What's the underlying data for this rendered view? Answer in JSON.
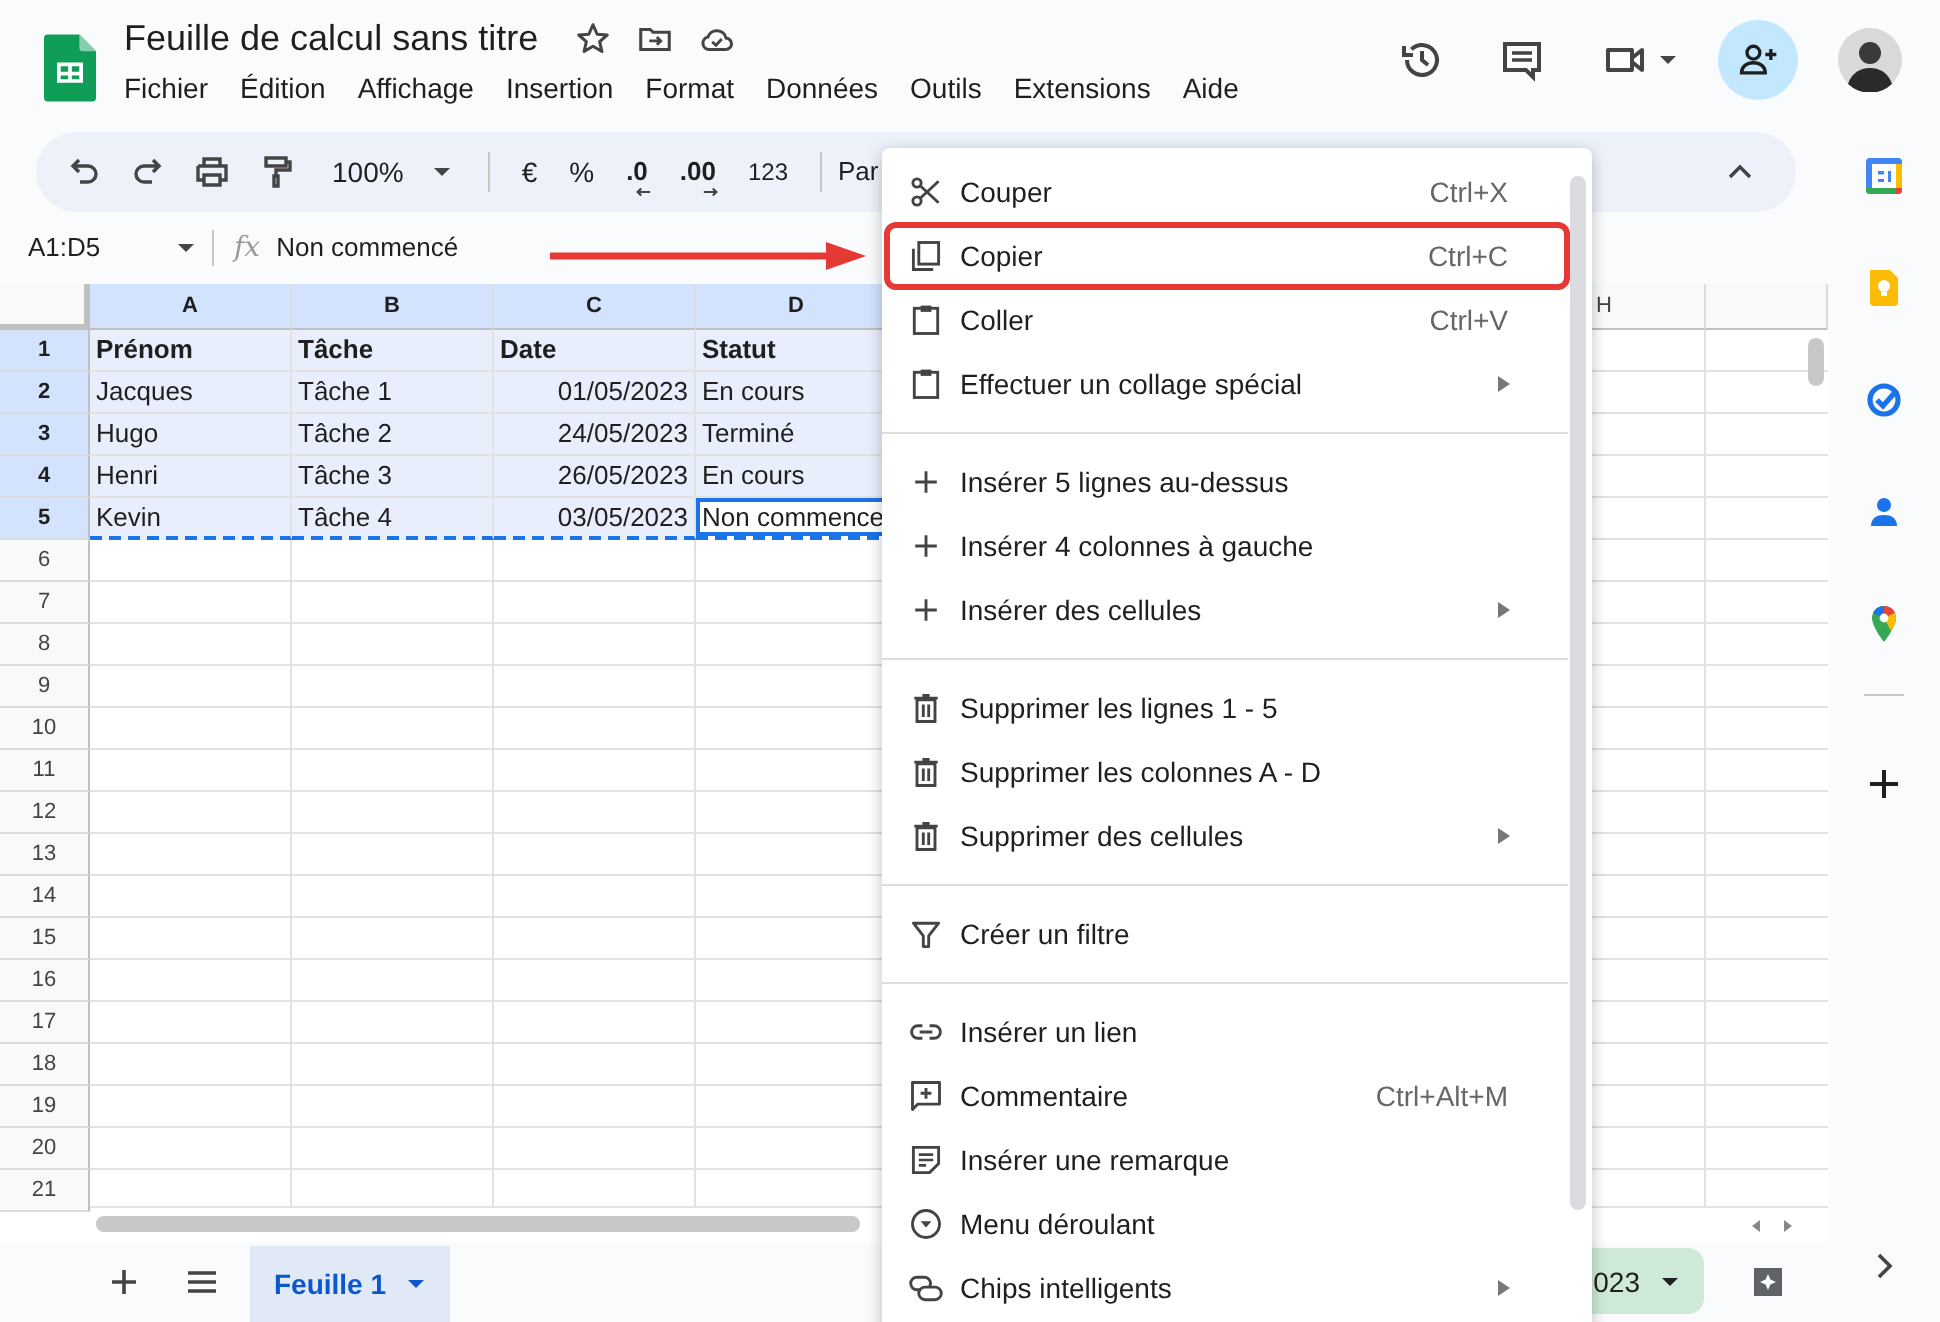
{
  "app": {
    "title": "Feuille de calcul sans titre",
    "menus": [
      "Fichier",
      "Édition",
      "Affichage",
      "Insertion",
      "Format",
      "Données",
      "Outils",
      "Extensions",
      "Aide"
    ]
  },
  "toolbar": {
    "zoom": "100%",
    "format_buttons": [
      "€",
      "%",
      ".0",
      ".00",
      "123"
    ],
    "font": "Par"
  },
  "formula_bar": {
    "name_box": "A1:D5",
    "fx": "fx",
    "value": "Non commencé"
  },
  "grid": {
    "columns": [
      {
        "label": "A",
        "selected": true
      },
      {
        "label": "B",
        "selected": true
      },
      {
        "label": "C",
        "selected": true
      },
      {
        "label": "D",
        "selected": true
      },
      {
        "label": "H",
        "selected": false
      }
    ],
    "rows": [
      {
        "label": "1",
        "selected": true,
        "cells": [
          {
            "text": "Prénom",
            "kind": "header",
            "active": false
          },
          {
            "text": "Tâche",
            "kind": "header",
            "active": false
          },
          {
            "text": "Date",
            "kind": "header",
            "active": false
          },
          {
            "text": "Statut",
            "kind": "header",
            "active": false
          }
        ]
      },
      {
        "label": "2",
        "selected": true,
        "cells": [
          {
            "text": "Jacques",
            "kind": "text",
            "active": false
          },
          {
            "text": "Tâche 1",
            "kind": "text",
            "active": false
          },
          {
            "text": "01/05/2023",
            "kind": "date",
            "active": false
          },
          {
            "text": "En cours",
            "kind": "text",
            "active": false
          }
        ]
      },
      {
        "label": "3",
        "selected": true,
        "cells": [
          {
            "text": "Hugo",
            "kind": "text",
            "active": false
          },
          {
            "text": "Tâche 2",
            "kind": "text",
            "active": false
          },
          {
            "text": "24/05/2023",
            "kind": "date",
            "active": false
          },
          {
            "text": "Terminé",
            "kind": "text",
            "active": false
          }
        ]
      },
      {
        "label": "4",
        "selected": true,
        "cells": [
          {
            "text": "Henri",
            "kind": "text",
            "active": false
          },
          {
            "text": "Tâche 3",
            "kind": "text",
            "active": false
          },
          {
            "text": "26/05/2023",
            "kind": "date",
            "active": false
          },
          {
            "text": "En cours",
            "kind": "text",
            "active": false
          }
        ]
      },
      {
        "label": "5",
        "selected": true,
        "cells": [
          {
            "text": "Kevin",
            "kind": "text",
            "active": false
          },
          {
            "text": "Tâche 4",
            "kind": "text",
            "active": false
          },
          {
            "text": "03/05/2023",
            "kind": "date",
            "active": false
          },
          {
            "text": "Non commence",
            "kind": "text",
            "active": true
          }
        ]
      },
      {
        "label": "6",
        "selected": false
      },
      {
        "label": "7",
        "selected": false
      },
      {
        "label": "8",
        "selected": false
      },
      {
        "label": "9",
        "selected": false
      },
      {
        "label": "10",
        "selected": false
      },
      {
        "label": "11",
        "selected": false
      },
      {
        "label": "12",
        "selected": false
      },
      {
        "label": "13",
        "selected": false
      },
      {
        "label": "14",
        "selected": false
      },
      {
        "label": "15",
        "selected": false
      },
      {
        "label": "16",
        "selected": false
      },
      {
        "label": "17",
        "selected": false
      },
      {
        "label": "18",
        "selected": false
      },
      {
        "label": "19",
        "selected": false
      },
      {
        "label": "20",
        "selected": false
      },
      {
        "label": "21",
        "selected": false
      }
    ]
  },
  "sheet_tabs": [
    {
      "label": "Feuille 1",
      "selected": true,
      "color": "#e1e9f7"
    },
    {
      "label": "023",
      "selected": false,
      "color": "#ceead6"
    }
  ],
  "context_menu": {
    "groups": [
      [
        {
          "label": "Couper",
          "shortcut": "Ctrl+X",
          "submenu": false,
          "highlighted": false
        },
        {
          "label": "Copier",
          "shortcut": "Ctrl+C",
          "submenu": false,
          "highlighted": true
        },
        {
          "label": "Coller",
          "shortcut": "Ctrl+V",
          "submenu": false,
          "highlighted": false
        },
        {
          "label": "Effectuer un collage spécial",
          "submenu": true,
          "highlighted": false
        }
      ],
      [
        {
          "label": "Insérer 5 lignes au-dessus",
          "submenu": false,
          "highlighted": false
        },
        {
          "label": "Insérer 4 colonnes à gauche",
          "submenu": false,
          "highlighted": false
        },
        {
          "label": "Insérer des cellules",
          "submenu": true,
          "highlighted": false
        }
      ],
      [
        {
          "label": "Supprimer les lignes 1 - 5",
          "submenu": false,
          "highlighted": false
        },
        {
          "label": "Supprimer les colonnes A - D",
          "submenu": false,
          "highlighted": false
        },
        {
          "label": "Supprimer des cellules",
          "submenu": true,
          "highlighted": false
        }
      ],
      [
        {
          "label": "Créer un filtre",
          "submenu": false,
          "highlighted": false
        }
      ],
      [
        {
          "label": "Insérer un lien",
          "submenu": false,
          "highlighted": false
        },
        {
          "label": "Commentaire",
          "shortcut": "Ctrl+Alt+M",
          "submenu": false,
          "highlighted": false
        },
        {
          "label": "Insérer une remarque",
          "submenu": false,
          "highlighted": false
        },
        {
          "label": "Menu déroulant",
          "submenu": false,
          "highlighted": false
        },
        {
          "label": "Chips intelligents",
          "submenu": true,
          "highlighted": false
        }
      ]
    ]
  }
}
